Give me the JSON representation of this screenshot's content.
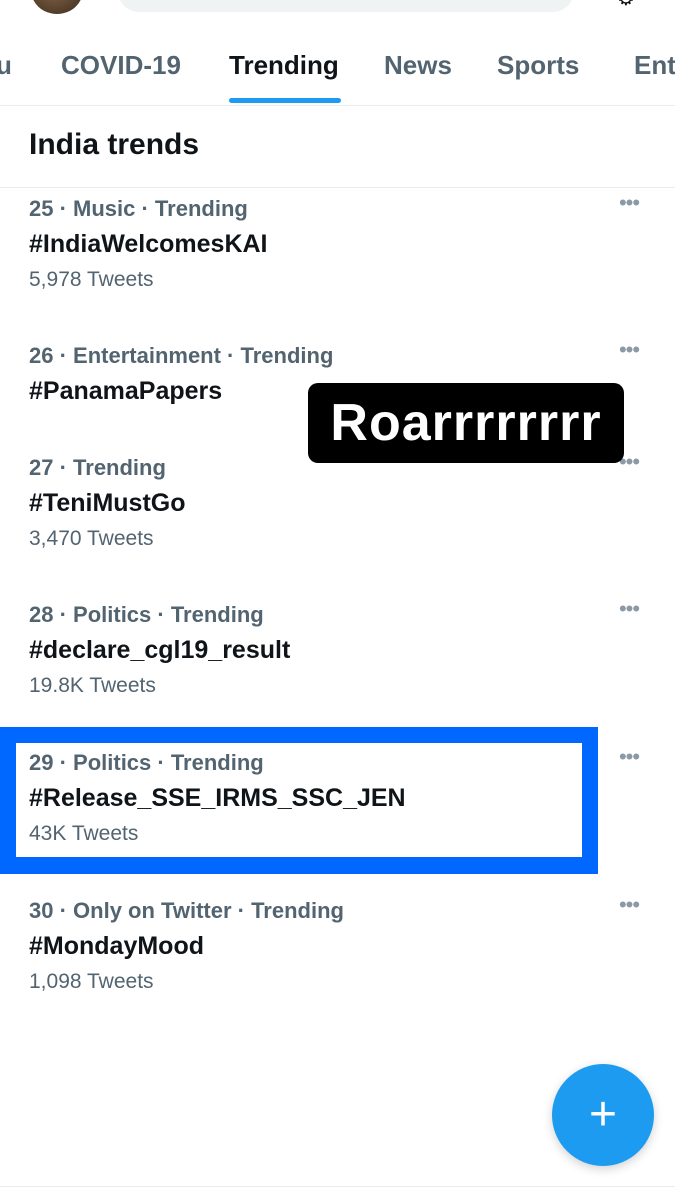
{
  "header": {
    "settings_icon": "settings-icon"
  },
  "tabs": [
    {
      "label": "u"
    },
    {
      "label": "COVID-19"
    },
    {
      "label": "Trending",
      "active": true
    },
    {
      "label": "News"
    },
    {
      "label": "Sports"
    },
    {
      "label": "Ent"
    }
  ],
  "section": {
    "title": "India trends"
  },
  "trends": [
    {
      "rank": "25",
      "meta": " · Music · Trending",
      "tag": "#IndiaWelcomesKAI",
      "count": "5,978 Tweets"
    },
    {
      "rank": "26",
      "meta": " · Entertainment · Trending",
      "tag": "#PanamaPapers",
      "count": ""
    },
    {
      "rank": "27",
      "meta": " · Trending",
      "tag": "#TeniMustGo",
      "count": "3,470 Tweets"
    },
    {
      "rank": "28",
      "meta": " · Politics · Trending",
      "tag": "#declare_cgl19_result",
      "count": "19.8K Tweets"
    },
    {
      "rank": "29",
      "meta": " · Politics · Trending",
      "tag": "#Release_SSE_IRMS_SSC_JEN",
      "count": "43K Tweets"
    },
    {
      "rank": "30",
      "meta": " · Only on Twitter · Trending",
      "tag": "#MondayMood",
      "count": "1,098 Tweets"
    }
  ],
  "overlay": {
    "text": "Roarrrrrrrr"
  },
  "fab": {
    "label": "+"
  },
  "colors": {
    "accent": "#1d9bf0",
    "highlight": "#0068ff",
    "muted": "#536471"
  }
}
